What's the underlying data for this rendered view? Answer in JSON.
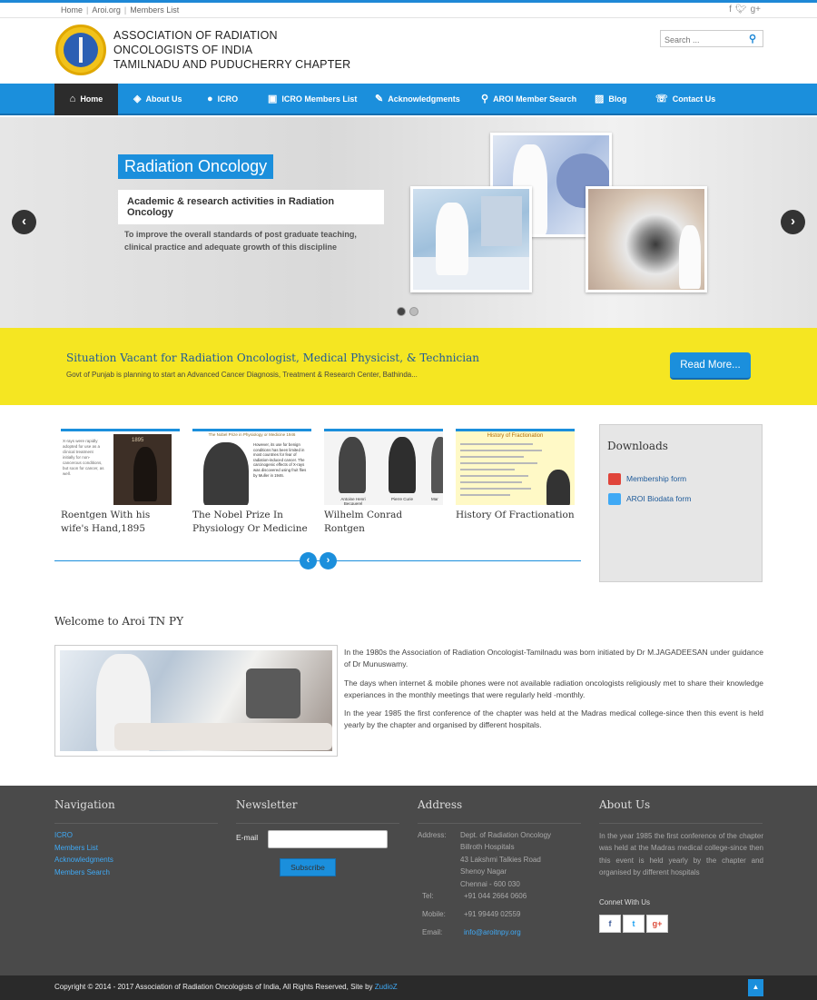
{
  "topbar": {
    "links": [
      "Home",
      "Aroi.org",
      "Members List"
    ],
    "social_icons": [
      "facebook-icon",
      "twitter-icon",
      "google-plus-icon"
    ]
  },
  "header": {
    "org_lines": [
      "ASSOCIATION OF RADIATION",
      "ONCOLOGISTS OF INDIA",
      "TAMILNADU AND PUDUCHERRY CHAPTER"
    ],
    "search_placeholder": "Search ..."
  },
  "nav": {
    "items": [
      {
        "label": "Home",
        "icon": "home-icon"
      },
      {
        "label": "About Us",
        "icon": "layers-icon"
      },
      {
        "label": "ICRO",
        "icon": "group-icon"
      },
      {
        "label": "ICRO Members List",
        "icon": "id-card-icon"
      },
      {
        "label": "Acknowledgments",
        "icon": "edit-icon"
      },
      {
        "label": "AROI Member Search",
        "icon": "search-icon"
      },
      {
        "label": "Blog",
        "icon": "image-icon"
      },
      {
        "label": "Contact Us",
        "icon": "phone-icon"
      }
    ]
  },
  "slider": {
    "title": "Radiation Oncology",
    "subtitle": "Academic & research activities in Radiation Oncology",
    "description": "To improve the overall standards of post graduate teaching, clinical practice and adequate growth of this discipline",
    "prev": "‹",
    "next": "›"
  },
  "banner": {
    "title": "Situation Vacant for Radiation Oncologist, Medical Physicist, & Technician",
    "text": "Govt of Punjab is planning to start an Advanced Cancer Diagnosis, Treatment & Research Center, Bathinda...",
    "button": "Read More..."
  },
  "carousel": {
    "items": [
      {
        "caption": "Roentgen With his wife's Hand,1895",
        "year": "1895",
        "img_text": "X-rays were rapidly adopted for use as a clinical treatment initially for non-cancerous conditions, but soon for cancer, as well."
      },
      {
        "caption": "The Nobel Prize In Physiology Or Medicine",
        "img_title": "The Nobel Prize in Physiology or Medicine 1946",
        "img_text": "However, its use for benign conditions has been limited in most countries for fear of radiation-induced cancer. The carcinogenic effects of X-rays was discovered using fruit flies by Muller in 1946."
      },
      {
        "caption": "Wilhelm Conrad Rontgen",
        "names": [
          "Antoine Henri Becquerel",
          "Pierre Curie",
          "Mar"
        ]
      },
      {
        "caption": "History Of Fractionation",
        "img_title": "History of Fractionation"
      }
    ],
    "prev": "‹",
    "next": "›"
  },
  "downloads": {
    "title": "Downloads",
    "items": [
      {
        "label": "Membership form",
        "color": "#e0443a"
      },
      {
        "label": "AROI Biodata form",
        "color": "#3fa9f5"
      }
    ]
  },
  "welcome": {
    "title": "Welcome to Aroi TN PY",
    "paragraphs": [
      "In the 1980s the Association of Radiation Oncologist-Tamilnadu was born initiated by Dr M.JAGADEESAN under guidance of Dr Munuswamy.",
      "The days when internet & mobile phones were not available radiation oncologists religiously met to share their knowledge experiances in the monthly meetings that were regularly held -monthly.",
      "In the year 1985 the first conference of the chapter was held at the Madras medical college-since then this event is held yearly by the chapter and organised by different hospitals."
    ]
  },
  "footer": {
    "navigation": {
      "title": "Navigation",
      "links": [
        "ICRO",
        "Members List",
        "Acknowledgments",
        "Members Search"
      ]
    },
    "newsletter": {
      "title": "Newsletter",
      "email_label": "E-mail",
      "button": "Subscribe"
    },
    "address": {
      "title": "Address",
      "address_label": "Address:",
      "lines": [
        "Dept. of Radiation Oncology",
        "Billroth Hospitals",
        "43 Lakshmi Talkies Road",
        "Shenoy Nagar",
        "Chennai - 600 030"
      ],
      "tel_label": "Tel:",
      "tel": "+91 044 2664 0606",
      "mobile_label": "Mobile:",
      "mobile": "+91 99449 02559",
      "email_label": "Email:",
      "email": "info@aroitnpy.org"
    },
    "about": {
      "title": "About Us",
      "text": "In the year 1985 the first conference of the chapter was held at the Madras medical college-since then this event is held yearly by the chapter and organised by different hospitals",
      "connect": "Connet With Us",
      "social": [
        "f",
        "t",
        "g+"
      ]
    },
    "copyright": "Copyright © 2014 - 2017 Association of Radiation Oncologists of India, All Rights Reserved, Site by",
    "studio": "ZudioZ",
    "to_top": "▲"
  }
}
